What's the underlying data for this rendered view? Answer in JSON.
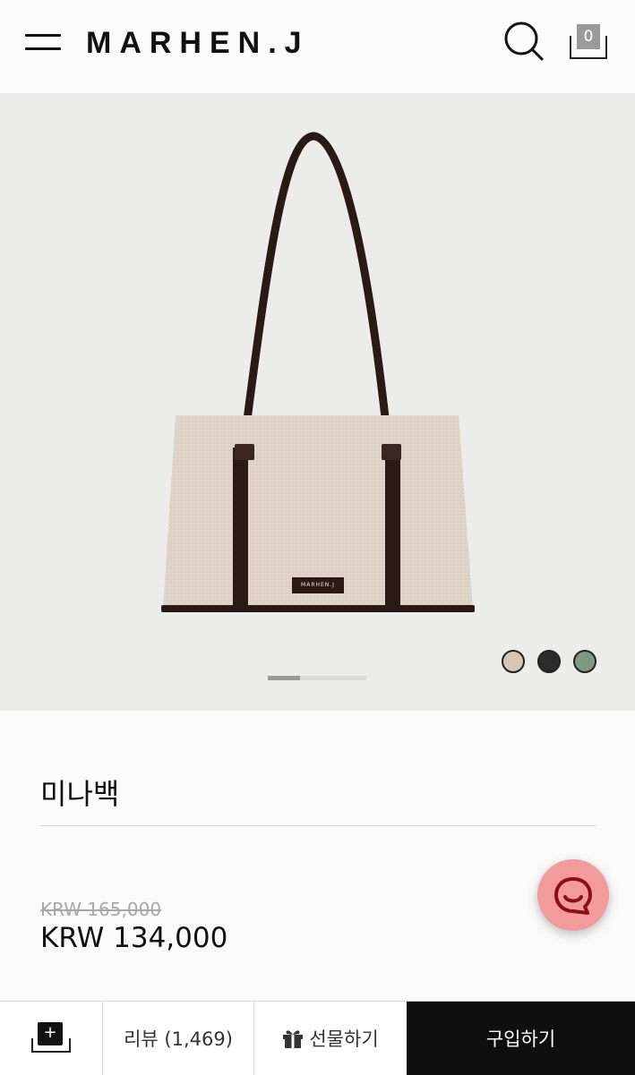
{
  "header": {
    "logo": "MARHEN.J",
    "cart_count": "0"
  },
  "gallery": {
    "bag_label": "MARHEN.J",
    "swatches": [
      {
        "name": "beige",
        "color": "#d9c6b2"
      },
      {
        "name": "black",
        "color": "#2b2b2b"
      },
      {
        "name": "sage",
        "color": "#7a9a82"
      }
    ],
    "slide_progress": 0.33
  },
  "product": {
    "name": "미나백",
    "original_price": "KRW 165,000",
    "price": "KRW 134,000"
  },
  "bottom_bar": {
    "add_icon": "+",
    "review_label": "리뷰 (1,469)",
    "gift_label": "선물하기",
    "buy_label": "구입하기"
  },
  "colors": {
    "accent_chat": "#f29a9c",
    "buy_bg": "#0f0f0f"
  }
}
